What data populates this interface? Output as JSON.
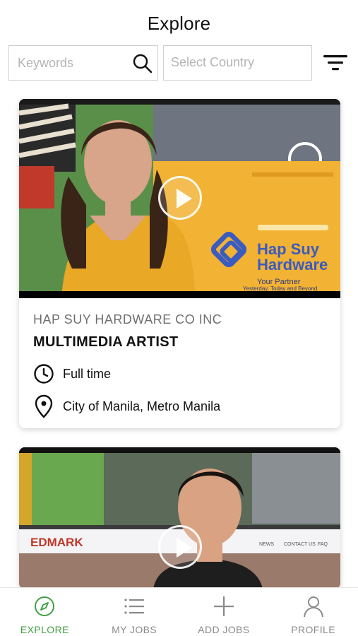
{
  "header": {
    "title": "Explore"
  },
  "search": {
    "keywords_placeholder": "Keywords",
    "country_placeholder": "Select Country"
  },
  "jobs": [
    {
      "company": "HAP SUY HARDWARE CO INC",
      "title": "MULTIMEDIA ARTIST",
      "type": "Full time",
      "location": "City of Manila, Metro Manila",
      "video_brand_text": [
        "Hap Suy",
        "Hardware",
        "Your Partner",
        "Yesterday, Today and Beyond."
      ]
    },
    {
      "video_brand_text": [
        "EDMARK",
        "NEWS",
        "CONTACT US",
        "FAQ"
      ]
    }
  ],
  "tabs": [
    {
      "label": "EXPLORE",
      "icon": "compass-icon",
      "active": true
    },
    {
      "label": "MY JOBS",
      "icon": "list-icon",
      "active": false
    },
    {
      "label": "ADD JOBS",
      "icon": "plus-icon",
      "active": false
    },
    {
      "label": "PROFILE",
      "icon": "user-icon",
      "active": false
    }
  ],
  "colors": {
    "accent": "#43a047",
    "inactive": "#8a8a8a",
    "brand_yellow": "#f2b233",
    "brand_blue": "#3a5bbf"
  }
}
